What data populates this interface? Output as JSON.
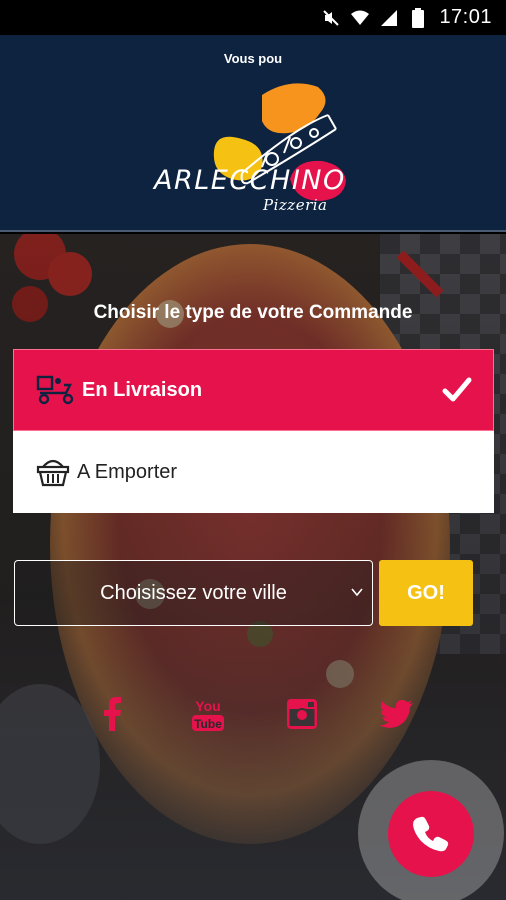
{
  "status_bar": {
    "time": "17:01",
    "icons": [
      "mute-icon",
      "wifi-icon",
      "signal-icon",
      "battery-icon"
    ]
  },
  "header": {
    "tagline": "Vous pou",
    "brand_name": "ARLECCHINO",
    "brand_sub": "Pizzeria",
    "colors": {
      "background": "#0d2340",
      "logo_orange": "#f7941d",
      "logo_yellow": "#f5c112",
      "logo_red": "#e6124b"
    }
  },
  "order": {
    "title": "Choisir le type de votre Commande",
    "options": [
      {
        "label": "En Livraison",
        "icon": "delivery-scooter-icon",
        "selected": true
      },
      {
        "label": "A Emporter",
        "icon": "basket-icon",
        "selected": false
      }
    ]
  },
  "city": {
    "placeholder": "Choisissez votre ville",
    "go_label": "GO!"
  },
  "social": [
    {
      "name": "facebook-icon"
    },
    {
      "name": "youtube-icon",
      "text": "You Tube"
    },
    {
      "name": "instagram-icon"
    },
    {
      "name": "twitter-icon"
    }
  ],
  "call": {
    "icon": "phone-icon"
  },
  "colors": {
    "accent": "#e6124b",
    "go": "#f5c112"
  }
}
